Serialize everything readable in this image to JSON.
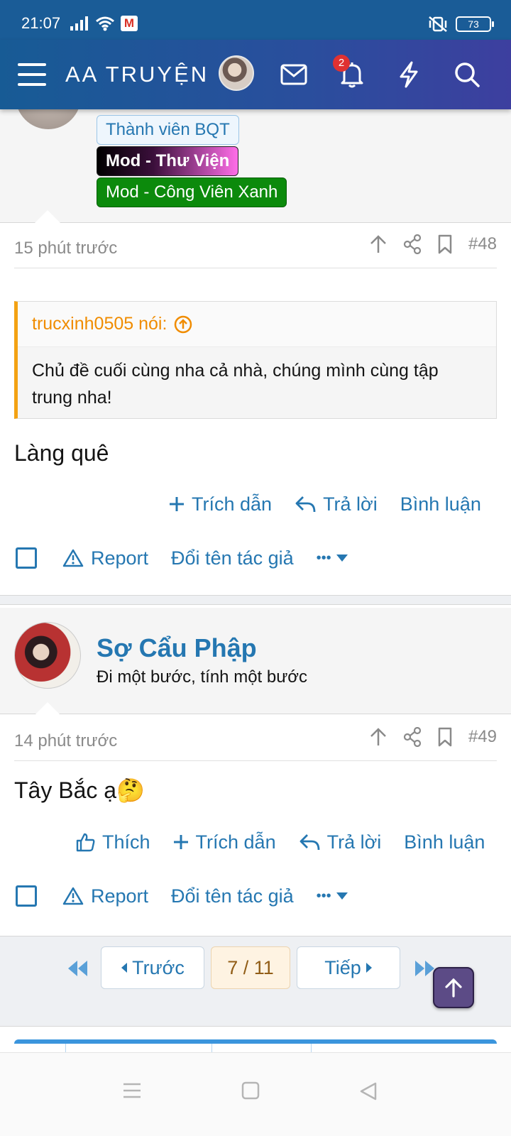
{
  "status_bar": {
    "time": "21:07",
    "battery": "73",
    "mail_icon_letter": "M"
  },
  "header": {
    "logo": "AA TRUYỆN",
    "notification_count": "2"
  },
  "post48": {
    "tags": [
      "Thành viên BQT",
      "Mod - Thư Viện",
      "Mod - Công Viên Xanh"
    ],
    "time": "15 phút trước",
    "number": "#48",
    "quote_author": "trucxinh0505 nói:",
    "quote_text": "Chủ đề cuối cùng nha cả nhà, chúng mình cùng tập trung nha!",
    "text": "Làng quê",
    "actions": {
      "quote": "Trích dẫn",
      "reply": "Trả lời",
      "comment": "Bình luận"
    },
    "tools": {
      "report": "Report",
      "rename": "Đổi tên tác giả",
      "more": "•••"
    }
  },
  "post49": {
    "author": "Sợ Cẩu Phập",
    "user_title": "Đi một bước, tính một bước",
    "time": "14 phút trước",
    "number": "#49",
    "text": "Tây Bắc ạ🤔",
    "actions": {
      "like": "Thích",
      "quote": "Trích dẫn",
      "reply": "Trả lời",
      "comment": "Bình luận"
    },
    "tools": {
      "report": "Report",
      "rename": "Đổi tên tác giả",
      "more": "•••"
    }
  },
  "pagination": {
    "prev": "Trước",
    "current": "7 / 11",
    "next": "Tiếp"
  },
  "colors": {
    "accent": "#2577b1",
    "header_start": "#175b95",
    "header_end": "#3d3f9f",
    "quote_border": "#f3a213"
  }
}
